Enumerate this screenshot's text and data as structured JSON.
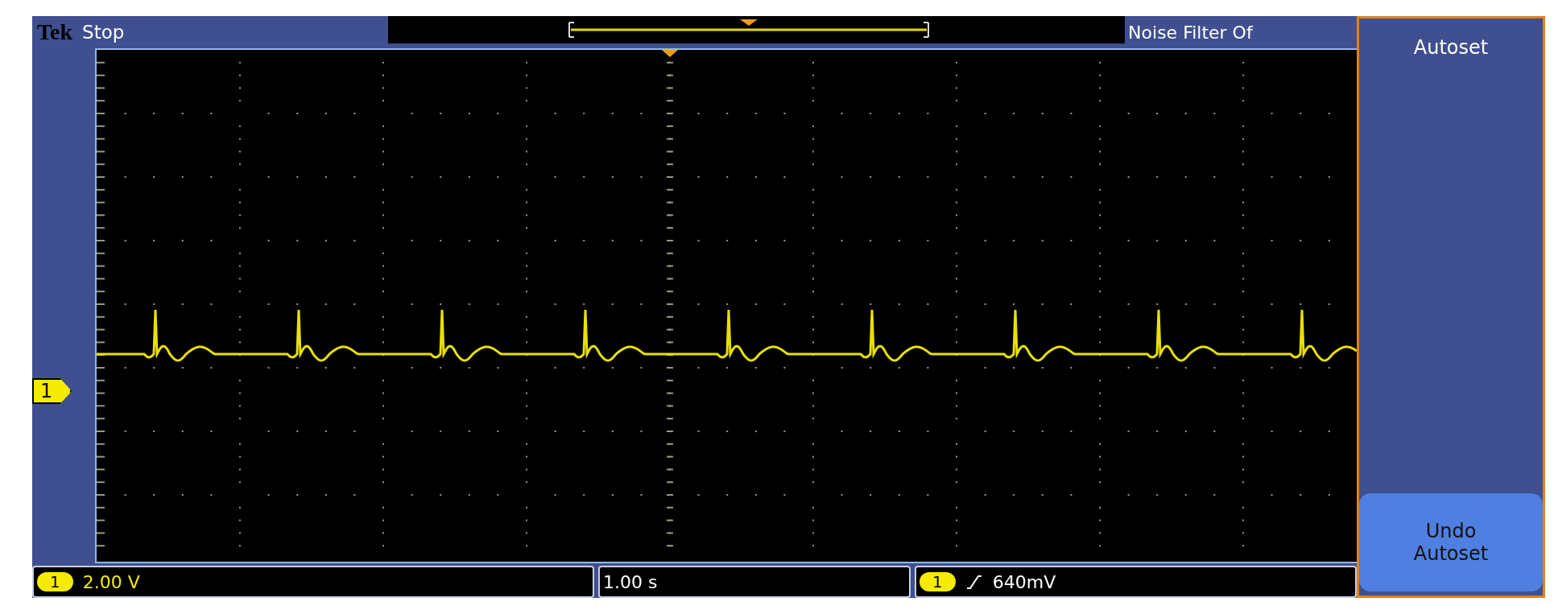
{
  "header": {
    "brand": "Tek",
    "status": "Stop",
    "noise_filter": "Noise Filter Of"
  },
  "channel_marker": "1",
  "readouts": {
    "vertical": {
      "channel": "1",
      "scale": "2.00 V"
    },
    "horizontal": {
      "scale": "1.00 s"
    },
    "trigger": {
      "channel": "1",
      "threshold": "640mV"
    }
  },
  "side_menu": [
    {
      "label": "Autoset",
      "kind": "title"
    },
    {
      "label": "Undo Autoset",
      "kind": "button"
    }
  ]
}
